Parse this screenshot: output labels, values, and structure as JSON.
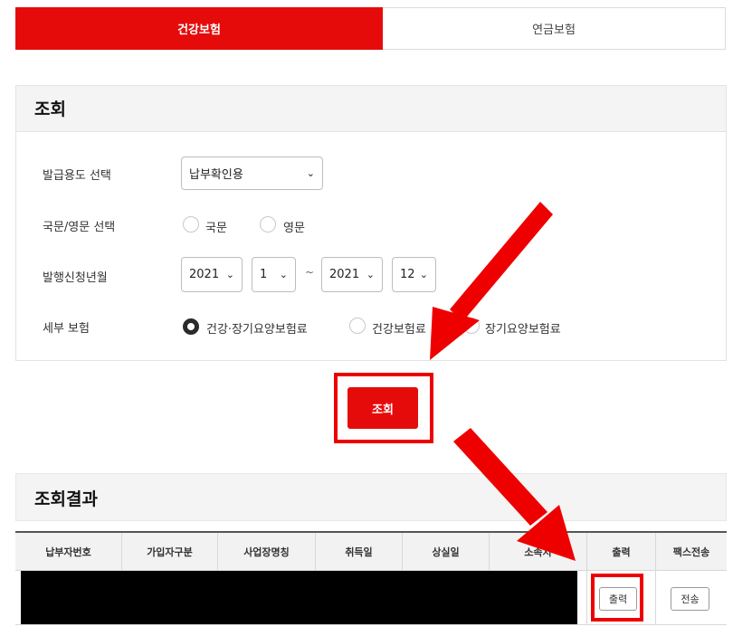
{
  "tabs": [
    {
      "label": "건강보험",
      "active": true
    },
    {
      "label": "연금보험",
      "active": false
    }
  ],
  "search": {
    "title": "조회",
    "purpose_label": "발급용도 선택",
    "purpose_value": "납부확인용",
    "language_label": "국문/영문 선택",
    "language_options": [
      "국문",
      "영문"
    ],
    "period_label": "발행신청년월",
    "from_year": "2021",
    "from_month": "1",
    "range_sep": "~",
    "to_year": "2021",
    "to_month": "12",
    "detail_label": "세부 보험",
    "detail_options": [
      "건강·장기요양보험료",
      "건강보험료",
      "장기요양보험료"
    ],
    "detail_selected": 0,
    "submit_label": "조회"
  },
  "results": {
    "title": "조회결과",
    "columns": [
      "납부자번호",
      "가입자구분",
      "사업장명칭",
      "취득일",
      "상실일",
      "소속지",
      "출력",
      "팩스전송"
    ],
    "row": {
      "print_label": "출력",
      "send_label": "전송"
    }
  },
  "colors": {
    "accent": "#e60b0b",
    "annotation": "#ee0000"
  }
}
